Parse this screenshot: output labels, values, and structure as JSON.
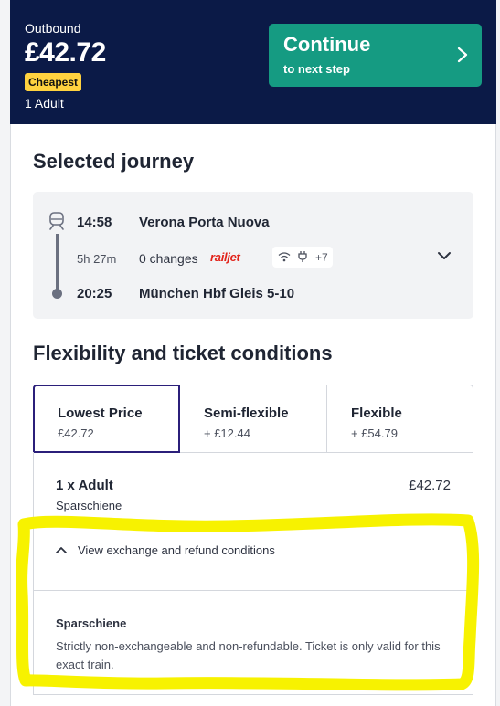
{
  "header": {
    "direction": "Outbound",
    "price": "£42.72",
    "badge": "Cheapest",
    "passengers": "1 Adult",
    "continue_label": "Continue",
    "continue_sub": "to next step"
  },
  "selected_journey": {
    "title": "Selected journey",
    "departure_time": "14:58",
    "departure_station": "Verona Porta Nuova",
    "duration": "5h 27m",
    "changes": "0 changes",
    "operator": "railjet",
    "amenities_more": "+7",
    "arrival_time": "20:25",
    "arrival_station": "München Hbf Gleis 5-10"
  },
  "flexibility": {
    "title": "Flexibility and ticket conditions",
    "tabs": [
      {
        "title": "Lowest Price",
        "price": "£42.72"
      },
      {
        "title": "Semi-flexible",
        "price": "+ £12.44"
      },
      {
        "title": "Flexible",
        "price": "+ £54.79"
      }
    ],
    "passenger_line": "1 x Adult",
    "passenger_price": "£42.72",
    "fare_name": "Sparschiene",
    "toggle_label": "View exchange and refund conditions",
    "condition_title": "Sparschiene",
    "condition_text": "Strictly non-exchangeable and non-refundable. Ticket is only valid for this exact train."
  },
  "colors": {
    "header_bg": "#0b1a47",
    "continue_bg": "#159b82",
    "badge_bg": "#ffd23f",
    "active_tab_border": "#2b1f7a",
    "operator_red": "#e2231a",
    "annotation_highlight": "#f7f200"
  }
}
